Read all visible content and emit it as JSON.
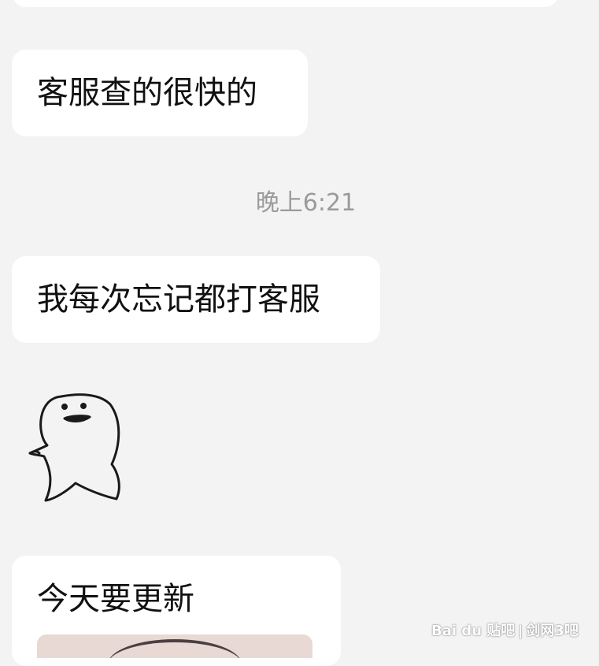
{
  "messages": [
    {
      "text": "客服查的很快的"
    },
    {
      "text": "我每次忘记都打客服"
    },
    {
      "text": "今天要更新"
    }
  ],
  "timestamp": "晚上6:21",
  "sticker": {
    "icon": "waving-blob-sticker-icon"
  },
  "watermark": {
    "brand": "Bai du 贴吧",
    "forum": "剑网3吧"
  }
}
